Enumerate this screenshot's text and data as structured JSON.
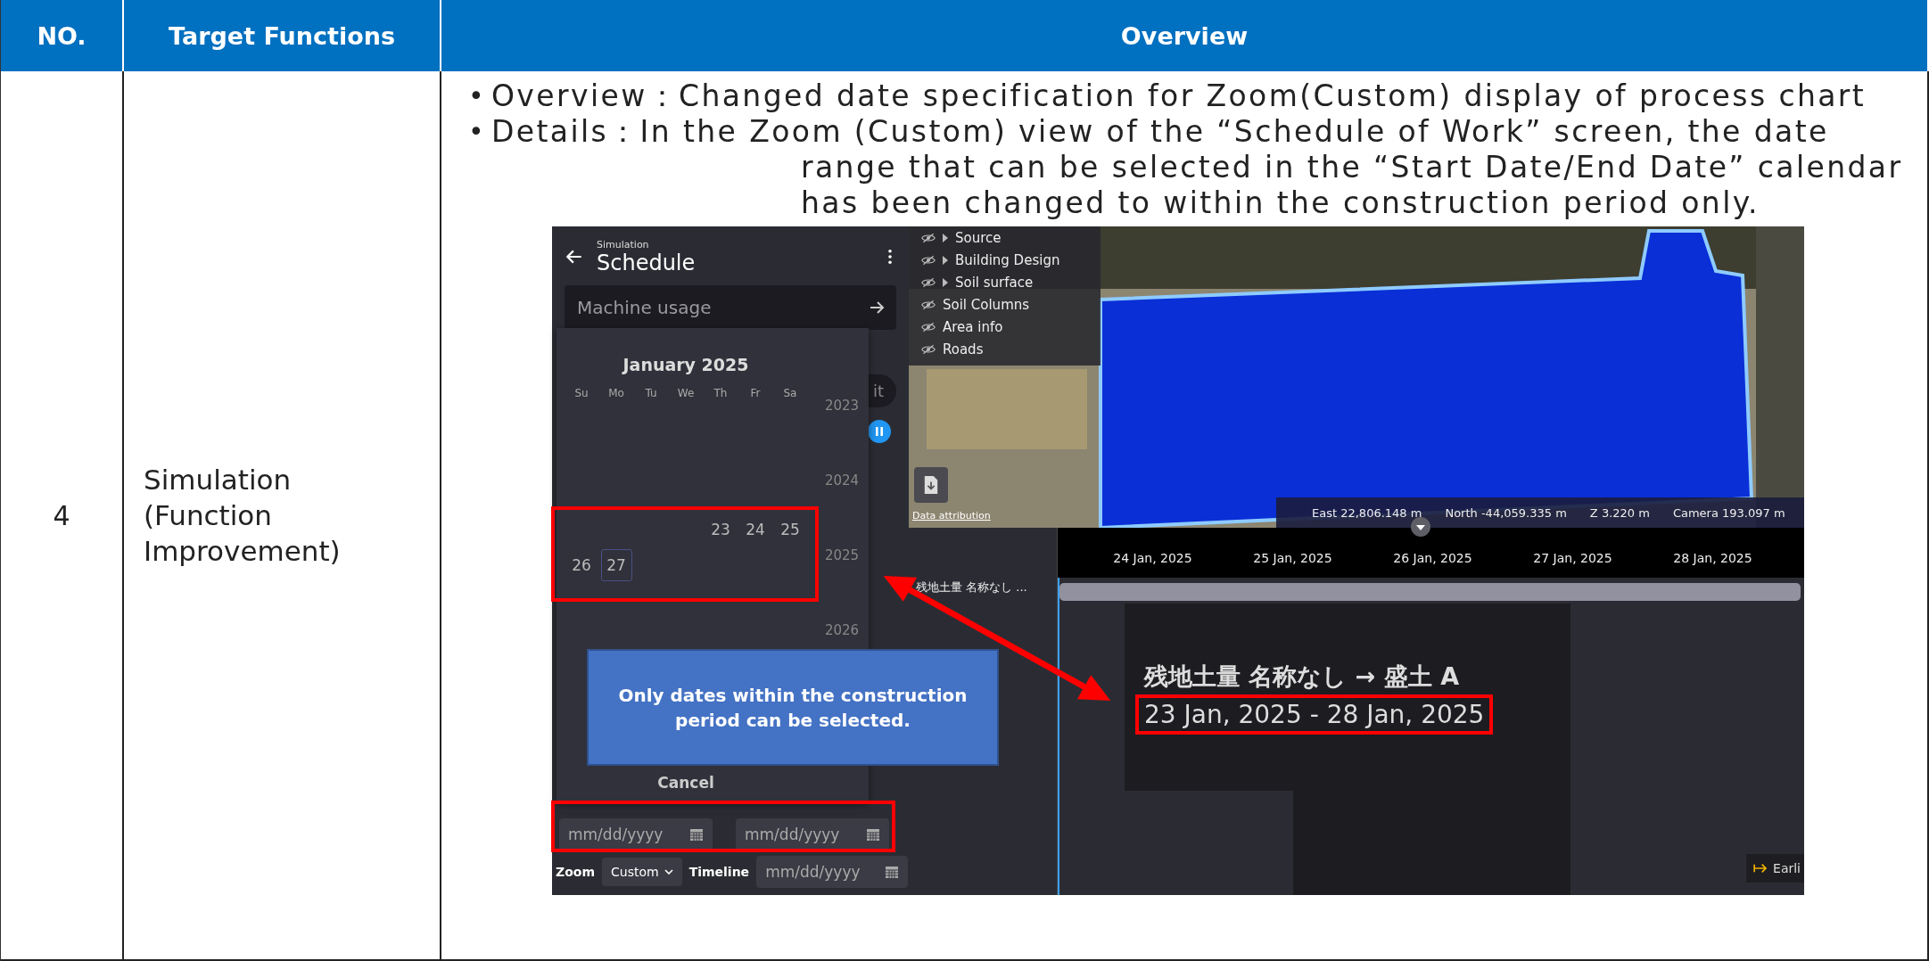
{
  "table": {
    "columns": [
      {
        "label": "NO."
      },
      {
        "label": "Target Functions"
      },
      {
        "label": "Overview"
      }
    ],
    "row": {
      "no": "4",
      "target": "Simulation (Function Improvement)",
      "bullets": [
        {
          "marker": "•",
          "label": "Overview：",
          "text": "Changed date specification for Zoom(Custom) display of process chart"
        },
        {
          "marker": "•",
          "label": "Details：",
          "text": "In the Zoom (Custom) view of the “Schedule of Work” screen, the date range that can be selected in the “Start Date/End Date” calendar has been changed to within the construction period only."
        }
      ],
      "screenshot": {
        "panel": {
          "subtitle": "Simulation",
          "title": "Schedule",
          "search_placeholder": "Machine usage",
          "hidden_button_text": "it",
          "calendar": {
            "month": "January 2025",
            "weekdays": [
              "Su",
              "Mo",
              "Tu",
              "We",
              "Th",
              "Fr",
              "Sa"
            ],
            "dates": [
              {
                "label": "23",
                "selected": false
              },
              {
                "label": "24",
                "selected": false
              },
              {
                "label": "25",
                "selected": false
              },
              {
                "label": "26",
                "selected": false
              },
              {
                "label": "27",
                "selected": true
              }
            ],
            "years": [
              "2023",
              "2024",
              "2025",
              "2026"
            ],
            "cancel": "Cancel"
          },
          "date_inputs": [
            {
              "placeholder": "mm/dd/yyyy"
            },
            {
              "placeholder": "mm/dd/yyyy"
            }
          ],
          "zoom": {
            "label": "Zoom",
            "value": "Custom"
          },
          "timeline": {
            "label": "Timeline",
            "placeholder": "mm/dd/yyyy"
          }
        },
        "map": {
          "layers": [
            {
              "label": "Source",
              "expandable": true
            },
            {
              "label": "Building Design",
              "expandable": true
            },
            {
              "label": "Soil surface",
              "expandable": true
            },
            {
              "label": "Soil Columns",
              "expandable": false
            },
            {
              "label": "Area info",
              "expandable": false
            },
            {
              "label": "Roads",
              "expandable": false
            }
          ],
          "attribution": "Data attribution",
          "coordinates": [
            "East 22,806.148 m",
            "North -44,059.335 m",
            "Z 3.220 m",
            "Camera 193.097 m"
          ]
        },
        "timeline": {
          "ticks": [
            "24 Jan, 2025",
            "25 Jan, 2025",
            "26 Jan, 2025",
            "27 Jan, 2025",
            "28 Jan, 2025"
          ],
          "row_label": "残地土量 名称なし ...",
          "tooltip": {
            "title": "残地土量 名称なし → 盛土 A",
            "range": "23 Jan, 2025 - 28 Jan, 2025"
          },
          "earlier_button": "Earli"
        },
        "note": "Only dates within the construction period can be selected."
      }
    }
  }
}
